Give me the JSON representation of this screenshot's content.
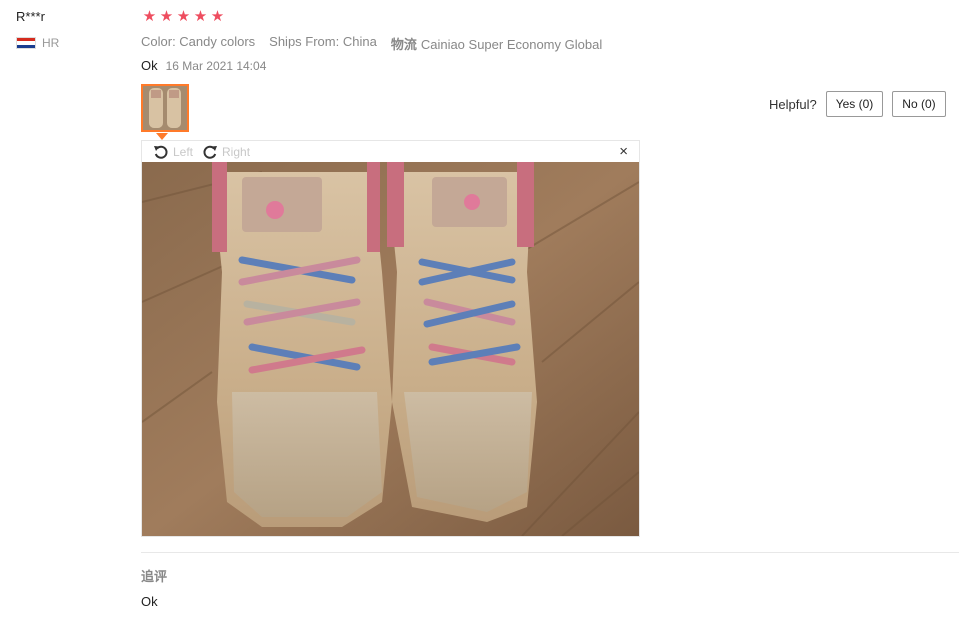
{
  "reviewer": {
    "name": "R***r",
    "country_code": "HR",
    "flag_icon": "croatia-flag-icon"
  },
  "review": {
    "rating": 5,
    "rating_max": 5,
    "star_color": "#ee4d5f",
    "color_attr": "Color: Candy colors",
    "ships_from": "Ships From: China",
    "logistics_cn": "物流",
    "logistics": "Cainiao Super Economy Global",
    "text": "Ok",
    "date": "16 Mar 2021 14:04"
  },
  "helpful": {
    "label": "Helpful?",
    "yes": "Yes (0)",
    "no": "No (0)"
  },
  "viewer": {
    "rotate_left_icon": "rotate-left-icon",
    "rotate_left": "Left",
    "rotate_right_icon": "rotate-right-icon",
    "rotate_right": "Right",
    "close_icon": "close-icon",
    "close": "×",
    "accent_color": "#ff7a2a"
  },
  "followup": {
    "label": "追评",
    "text": "Ok"
  }
}
